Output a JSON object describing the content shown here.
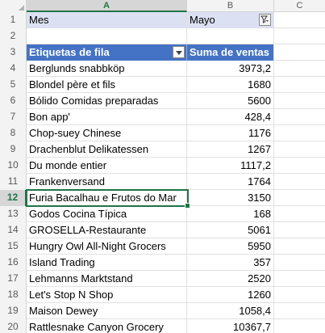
{
  "columns": [
    {
      "letter": "A",
      "selected": true
    },
    {
      "letter": "B",
      "selected": false
    },
    {
      "letter": "C",
      "selected": false
    }
  ],
  "filter": {
    "field": "Mes",
    "value": "Mayo",
    "icon": "filter-applied-icon"
  },
  "pivot_header": {
    "row_labels": "Etiquetas de fila",
    "values_label": "Suma de ventas",
    "dropdown_icon": "dropdown-arrow-icon"
  },
  "active_row": "12",
  "row_numbers": [
    "1",
    "2",
    "3",
    "4",
    "5",
    "6",
    "7",
    "8",
    "9",
    "10",
    "11",
    "12",
    "13",
    "14",
    "15",
    "16",
    "17",
    "18",
    "19",
    "20"
  ],
  "rows": [
    {
      "num": "4",
      "label": "Berglunds snabbköp",
      "value": "3973,2"
    },
    {
      "num": "5",
      "label": "Blondel père et fils",
      "value": "1680"
    },
    {
      "num": "6",
      "label": "Bólido Comidas preparadas",
      "value": "5600"
    },
    {
      "num": "7",
      "label": "Bon app'",
      "value": "428,4"
    },
    {
      "num": "8",
      "label": "Chop-suey Chinese",
      "value": "1176"
    },
    {
      "num": "9",
      "label": "Drachenblut Delikatessen",
      "value": "1267"
    },
    {
      "num": "10",
      "label": "Du monde entier",
      "value": "1117,2"
    },
    {
      "num": "11",
      "label": "Frankenversand",
      "value": "1764"
    },
    {
      "num": "12",
      "label": "Furia Bacalhau e Frutos do Mar",
      "value": "3150"
    },
    {
      "num": "13",
      "label": "Godos Cocina Típica",
      "value": "168"
    },
    {
      "num": "14",
      "label": "GROSELLA-Restaurante",
      "value": "5061"
    },
    {
      "num": "15",
      "label": "Hungry Owl All-Night Grocers",
      "value": "5950"
    },
    {
      "num": "16",
      "label": "Island Trading",
      "value": "357"
    },
    {
      "num": "17",
      "label": "Lehmanns Marktstand",
      "value": "2520"
    },
    {
      "num": "18",
      "label": "Let's Stop N Shop",
      "value": "1260"
    },
    {
      "num": "19",
      "label": "Maison Dewey",
      "value": "1058,4"
    },
    {
      "num": "20",
      "label": "Rattlesnake Canyon Grocery",
      "value": "10367,7"
    }
  ]
}
